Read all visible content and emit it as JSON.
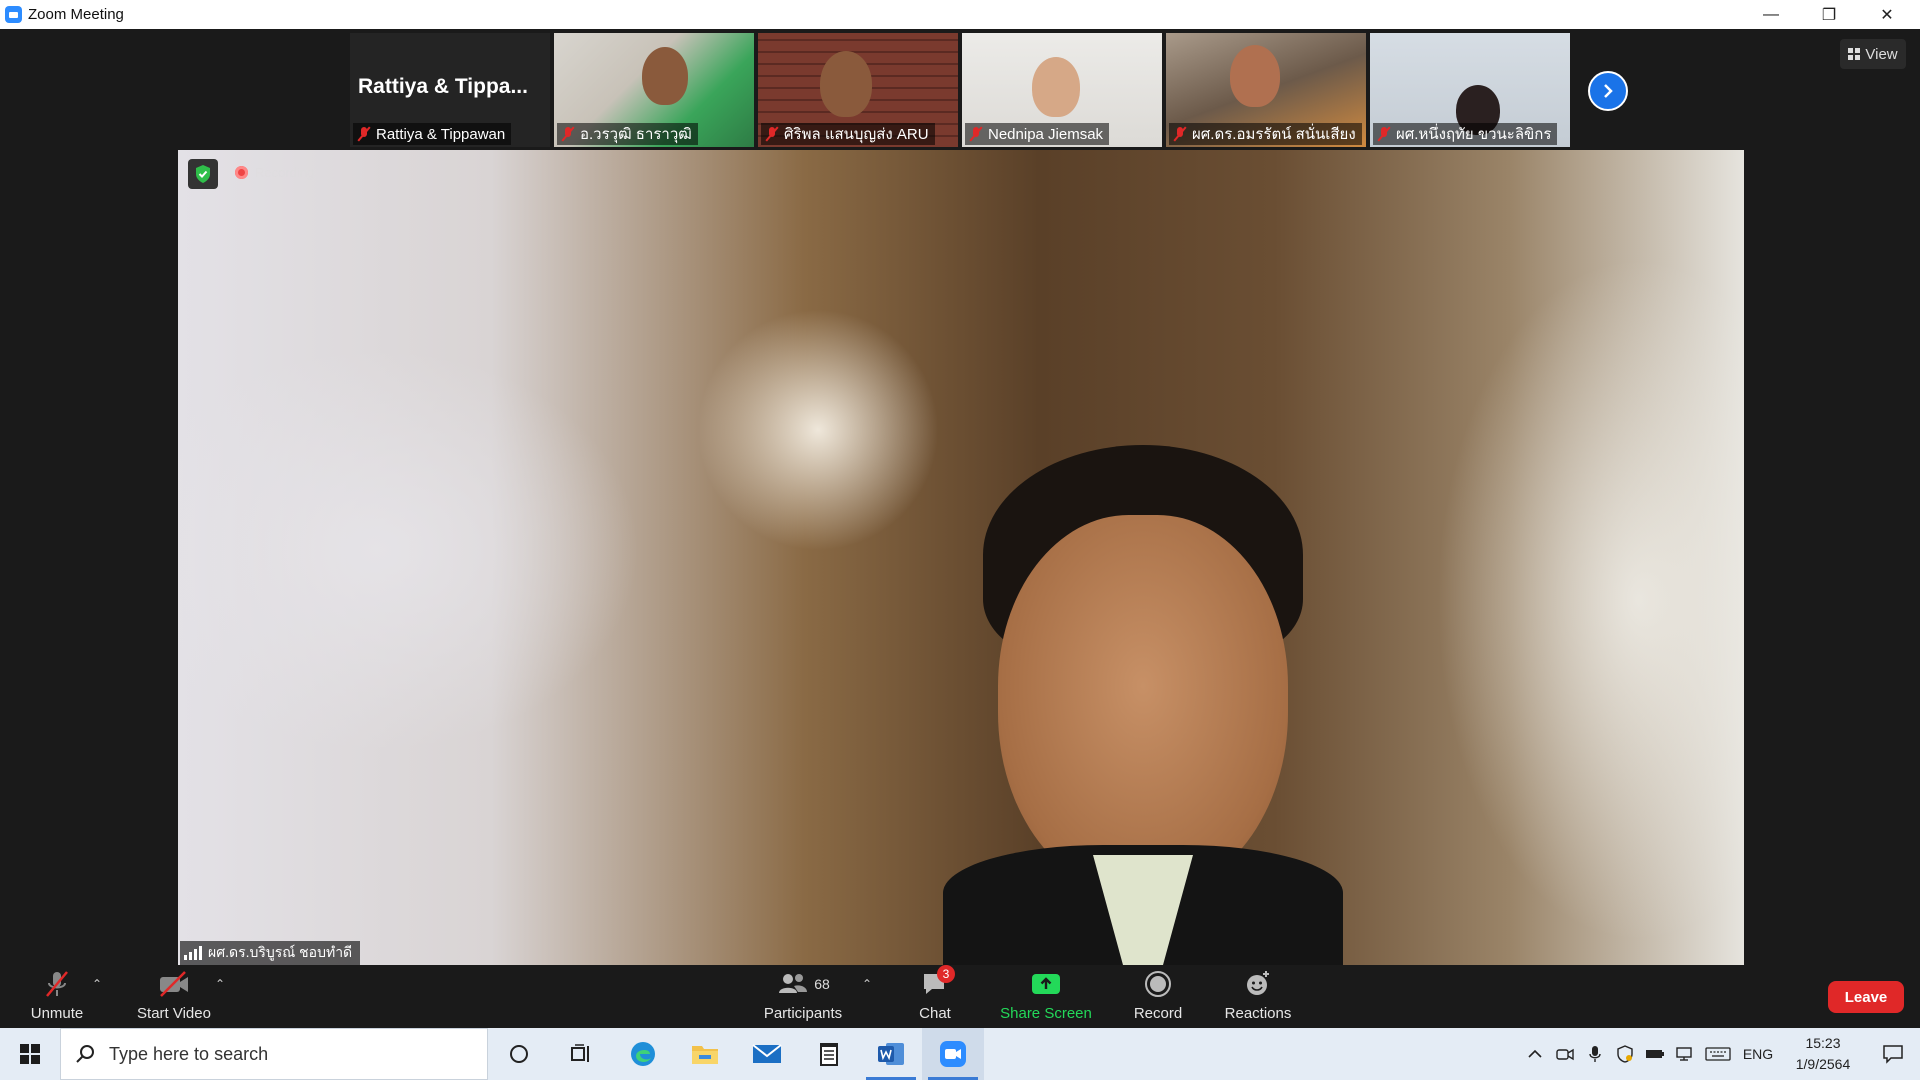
{
  "window": {
    "title": "Zoom Meeting",
    "controls": {
      "minimize": "—",
      "restore": "❐",
      "close": "✕"
    }
  },
  "gallery": {
    "text_tile": {
      "big_name": "Rattiya  &  Tippa...",
      "name": "Rattiya & Tippawan"
    },
    "participants": [
      {
        "name": "อ.วรวุฒิ ธาราวุฒิ"
      },
      {
        "name": "ศิริพล แสนบุญส่ง ARU"
      },
      {
        "name": "Nednipa Jiemsak"
      },
      {
        "name": "ผศ.ดร.อมรรัตน์  สนั่นเสียง"
      },
      {
        "name": "ผศ.หนึ่งฤทัย  ขวนะลิขิกร"
      }
    ],
    "view_label": "View"
  },
  "main_video": {
    "recording_label": "Recording",
    "speaker_name": "ผศ.ดร.บริบูรณ์ ชอบทำดี"
  },
  "toolbar": {
    "unmute": "Unmute",
    "start_video": "Start Video",
    "participants": "Participants",
    "participants_count": "68",
    "chat": "Chat",
    "chat_badge": "3",
    "share_screen": "Share Screen",
    "record": "Record",
    "reactions": "Reactions",
    "leave": "Leave",
    "share_color": "#23d959",
    "leave_color": "#e02828"
  },
  "taskbar": {
    "search_placeholder": "Type here to search",
    "language": "ENG",
    "time": "15:23",
    "date": "1/9/2564",
    "apps": [
      "cortana-icon",
      "task-view-icon",
      "edge-icon",
      "file-explorer-icon",
      "mail-icon",
      "notepad-icon",
      "word-icon",
      "zoom-icon"
    ]
  }
}
